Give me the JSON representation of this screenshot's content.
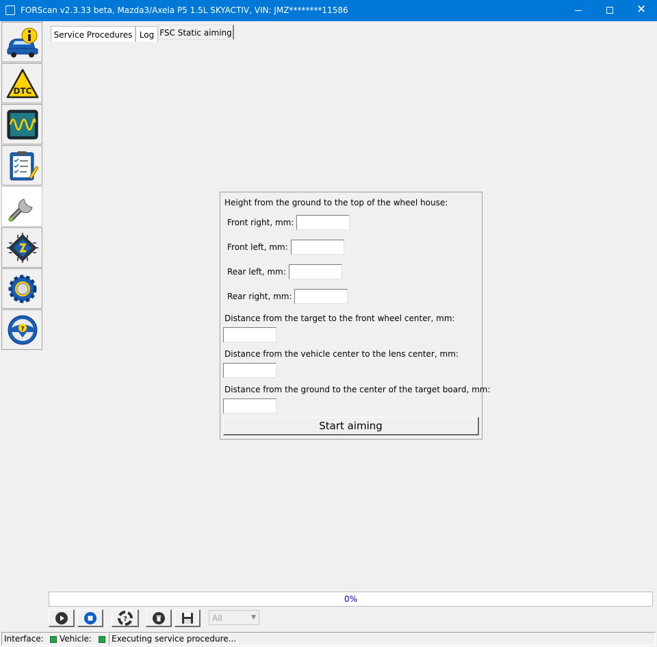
{
  "window": {
    "title": "FORScan v2.3.33 beta, Mazda3/Axela P5 1.5L SKYACTIV, VIN: JMZ********11586",
    "controls": {
      "minimize": "—",
      "maximize": "□",
      "close": "✕"
    }
  },
  "sidebar": {
    "items": [
      {
        "name": "vehicle-info",
        "icon": "car-info-icon",
        "active": false
      },
      {
        "name": "dtc",
        "icon": "dtc-warning-icon",
        "active": false
      },
      {
        "name": "oscilloscope",
        "icon": "oscilloscope-icon",
        "active": false
      },
      {
        "name": "tests",
        "icon": "checklist-icon",
        "active": false
      },
      {
        "name": "service",
        "icon": "wrench-icon",
        "active": true
      },
      {
        "name": "configuration",
        "icon": "chip-icon",
        "active": false
      },
      {
        "name": "settings",
        "icon": "gear-icon",
        "active": false
      },
      {
        "name": "help",
        "icon": "help-wheel-icon",
        "active": false
      }
    ]
  },
  "tabs": [
    {
      "label": "Service Procedures"
    },
    {
      "label": "Log"
    },
    {
      "label": "FSC Static aiming"
    }
  ],
  "form": {
    "wheel_house_heading": "Height from the ground to the top of the wheel house:",
    "front_right_label": "Front right, mm:",
    "front_left_label": "Front left, mm:",
    "rear_left_label": "Rear left, mm:",
    "rear_right_label": "Rear right, mm:",
    "target_front_wheel_label": "Distance from the target to the front wheel center, mm:",
    "vehicle_lens_label": "Distance from the vehicle center to the lens center, mm:",
    "ground_target_label": "Distance from the ground to the center of the target board, mm:",
    "values": {
      "front_right": "",
      "front_left": "",
      "rear_left": "",
      "rear_right": "",
      "target_front_wheel": "",
      "vehicle_lens": "",
      "ground_target": ""
    },
    "start_button": "Start aiming"
  },
  "progress": {
    "text": "0%",
    "value": 0,
    "fill_color": "#06b025"
  },
  "toolbar": {
    "buttons": [
      {
        "name": "run",
        "icon": "play-icon"
      },
      {
        "name": "stop",
        "icon": "stop-icon"
      },
      {
        "name": "help",
        "icon": "lifebuoy-icon"
      },
      {
        "name": "clear",
        "icon": "trash-icon"
      },
      {
        "name": "save",
        "icon": "save-icon"
      }
    ],
    "filter": {
      "value": "All"
    }
  },
  "status": {
    "interface_label": "Interface:",
    "vehicle_label": "Vehicle:",
    "interface_color": "#22a548",
    "vehicle_color": "#22a548",
    "message": "Executing service procedure..."
  },
  "colors": {
    "titlebar": "#0078d7",
    "accent_blue": "#0a5ec8",
    "led_green": "#22a548"
  }
}
